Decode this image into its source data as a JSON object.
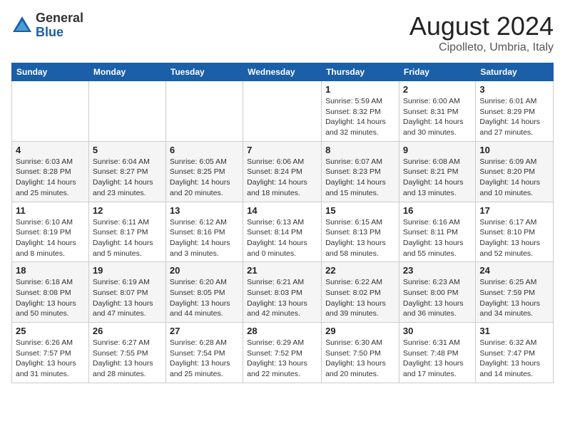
{
  "header": {
    "logo_general": "General",
    "logo_blue": "Blue",
    "month_title": "August 2024",
    "location": "Cipolleto, Umbria, Italy"
  },
  "calendar": {
    "days_of_week": [
      "Sunday",
      "Monday",
      "Tuesday",
      "Wednesday",
      "Thursday",
      "Friday",
      "Saturday"
    ],
    "weeks": [
      [
        {
          "day": "",
          "info": ""
        },
        {
          "day": "",
          "info": ""
        },
        {
          "day": "",
          "info": ""
        },
        {
          "day": "",
          "info": ""
        },
        {
          "day": "1",
          "info": "Sunrise: 5:59 AM\nSunset: 8:32 PM\nDaylight: 14 hours\nand 32 minutes."
        },
        {
          "day": "2",
          "info": "Sunrise: 6:00 AM\nSunset: 8:31 PM\nDaylight: 14 hours\nand 30 minutes."
        },
        {
          "day": "3",
          "info": "Sunrise: 6:01 AM\nSunset: 8:29 PM\nDaylight: 14 hours\nand 27 minutes."
        }
      ],
      [
        {
          "day": "4",
          "info": "Sunrise: 6:03 AM\nSunset: 8:28 PM\nDaylight: 14 hours\nand 25 minutes."
        },
        {
          "day": "5",
          "info": "Sunrise: 6:04 AM\nSunset: 8:27 PM\nDaylight: 14 hours\nand 23 minutes."
        },
        {
          "day": "6",
          "info": "Sunrise: 6:05 AM\nSunset: 8:25 PM\nDaylight: 14 hours\nand 20 minutes."
        },
        {
          "day": "7",
          "info": "Sunrise: 6:06 AM\nSunset: 8:24 PM\nDaylight: 14 hours\nand 18 minutes."
        },
        {
          "day": "8",
          "info": "Sunrise: 6:07 AM\nSunset: 8:23 PM\nDaylight: 14 hours\nand 15 minutes."
        },
        {
          "day": "9",
          "info": "Sunrise: 6:08 AM\nSunset: 8:21 PM\nDaylight: 14 hours\nand 13 minutes."
        },
        {
          "day": "10",
          "info": "Sunrise: 6:09 AM\nSunset: 8:20 PM\nDaylight: 14 hours\nand 10 minutes."
        }
      ],
      [
        {
          "day": "11",
          "info": "Sunrise: 6:10 AM\nSunset: 8:19 PM\nDaylight: 14 hours\nand 8 minutes."
        },
        {
          "day": "12",
          "info": "Sunrise: 6:11 AM\nSunset: 8:17 PM\nDaylight: 14 hours\nand 5 minutes."
        },
        {
          "day": "13",
          "info": "Sunrise: 6:12 AM\nSunset: 8:16 PM\nDaylight: 14 hours\nand 3 minutes."
        },
        {
          "day": "14",
          "info": "Sunrise: 6:13 AM\nSunset: 8:14 PM\nDaylight: 14 hours\nand 0 minutes."
        },
        {
          "day": "15",
          "info": "Sunrise: 6:15 AM\nSunset: 8:13 PM\nDaylight: 13 hours\nand 58 minutes."
        },
        {
          "day": "16",
          "info": "Sunrise: 6:16 AM\nSunset: 8:11 PM\nDaylight: 13 hours\nand 55 minutes."
        },
        {
          "day": "17",
          "info": "Sunrise: 6:17 AM\nSunset: 8:10 PM\nDaylight: 13 hours\nand 52 minutes."
        }
      ],
      [
        {
          "day": "18",
          "info": "Sunrise: 6:18 AM\nSunset: 8:08 PM\nDaylight: 13 hours\nand 50 minutes."
        },
        {
          "day": "19",
          "info": "Sunrise: 6:19 AM\nSunset: 8:07 PM\nDaylight: 13 hours\nand 47 minutes."
        },
        {
          "day": "20",
          "info": "Sunrise: 6:20 AM\nSunset: 8:05 PM\nDaylight: 13 hours\nand 44 minutes."
        },
        {
          "day": "21",
          "info": "Sunrise: 6:21 AM\nSunset: 8:03 PM\nDaylight: 13 hours\nand 42 minutes."
        },
        {
          "day": "22",
          "info": "Sunrise: 6:22 AM\nSunset: 8:02 PM\nDaylight: 13 hours\nand 39 minutes."
        },
        {
          "day": "23",
          "info": "Sunrise: 6:23 AM\nSunset: 8:00 PM\nDaylight: 13 hours\nand 36 minutes."
        },
        {
          "day": "24",
          "info": "Sunrise: 6:25 AM\nSunset: 7:59 PM\nDaylight: 13 hours\nand 34 minutes."
        }
      ],
      [
        {
          "day": "25",
          "info": "Sunrise: 6:26 AM\nSunset: 7:57 PM\nDaylight: 13 hours\nand 31 minutes."
        },
        {
          "day": "26",
          "info": "Sunrise: 6:27 AM\nSunset: 7:55 PM\nDaylight: 13 hours\nand 28 minutes."
        },
        {
          "day": "27",
          "info": "Sunrise: 6:28 AM\nSunset: 7:54 PM\nDaylight: 13 hours\nand 25 minutes."
        },
        {
          "day": "28",
          "info": "Sunrise: 6:29 AM\nSunset: 7:52 PM\nDaylight: 13 hours\nand 22 minutes."
        },
        {
          "day": "29",
          "info": "Sunrise: 6:30 AM\nSunset: 7:50 PM\nDaylight: 13 hours\nand 20 minutes."
        },
        {
          "day": "30",
          "info": "Sunrise: 6:31 AM\nSunset: 7:48 PM\nDaylight: 13 hours\nand 17 minutes."
        },
        {
          "day": "31",
          "info": "Sunrise: 6:32 AM\nSunset: 7:47 PM\nDaylight: 13 hours\nand 14 minutes."
        }
      ]
    ]
  }
}
